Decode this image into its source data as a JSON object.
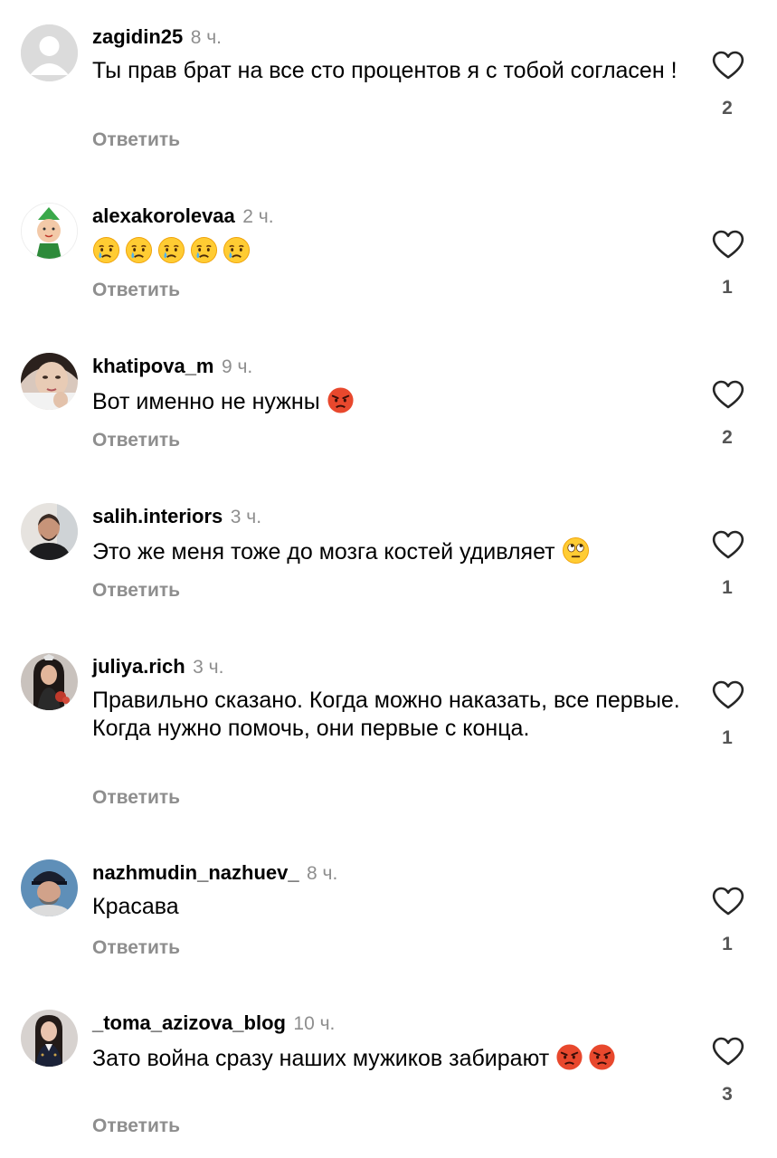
{
  "comments": [
    {
      "username": "zagidin25",
      "time": "8 ч.",
      "text": "Ты прав брат на все сто процентов я с тобой согласен !",
      "reply": "Ответить",
      "likes": "2"
    },
    {
      "username": "alexakorolevaa",
      "time": "2 ч.",
      "text": "",
      "emojis": [
        "crying-face-emoji",
        "crying-face-emoji",
        "crying-face-emoji",
        "crying-face-emoji",
        "crying-face-emoji"
      ],
      "reply": "Ответить",
      "likes": "1"
    },
    {
      "username": "khatipova_m",
      "time": "9 ч.",
      "text": "Вот именно  не нужны",
      "emojis": [
        "angry-face-emoji"
      ],
      "reply": "Ответить",
      "likes": "2"
    },
    {
      "username": "salih.interiors",
      "time": "3 ч.",
      "text": "Это же меня тоже до мозга костей удивляет",
      "emojis": [
        "eye-roll-emoji"
      ],
      "reply": "Ответить",
      "likes": "1"
    },
    {
      "username": "juliya.rich",
      "time": "3 ч.",
      "text": "Правильно сказано. Когда можно наказать, все первые. Когда нужно помочь, они первые с конца.",
      "reply": "Ответить",
      "likes": "1"
    },
    {
      "username": "nazhmudin_nazhuev_",
      "time": "8 ч.",
      "text": "Красава",
      "reply": "Ответить",
      "likes": "1"
    },
    {
      "username": "_toma_azizova_blog",
      "time": "10 ч.",
      "text": "Зато война сразу наших мужиков забирают",
      "emojis": [
        "angry-face-emoji",
        "angry-face-emoji"
      ],
      "reply": "Ответить",
      "likes": "3"
    }
  ],
  "icons": {
    "like": "heart-outline-icon",
    "default_avatar": "default-avatar-icon"
  },
  "colors": {
    "meta_gray": "#8e8e8e",
    "count_gray": "#555555",
    "angry_red": "#e8482d",
    "emoji_yellow": "#ffcc33"
  }
}
